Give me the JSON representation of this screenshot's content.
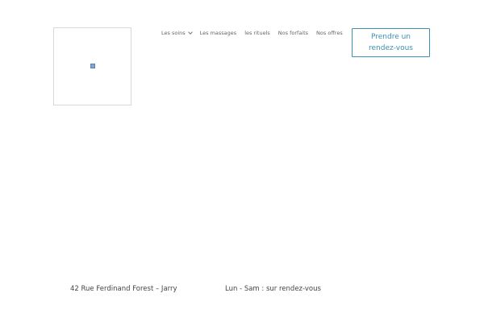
{
  "nav": {
    "items": [
      {
        "label": "Les soins",
        "has_dropdown": true
      },
      {
        "label": "Les massages",
        "has_dropdown": false
      },
      {
        "label": "les rituels",
        "has_dropdown": false
      },
      {
        "label": "Nos forfaits",
        "has_dropdown": false
      },
      {
        "label": "Nos offres",
        "has_dropdown": false
      }
    ]
  },
  "header": {
    "logo_icon": "broken-image-icon",
    "cta_label": "Prendre un rendez-vous"
  },
  "footer": {
    "address": "42 Rue Ferdinand Forest – Jarry",
    "hours": "Lun - Sam : sur rendez-vous"
  },
  "colors": {
    "accent": "#3e8fb5",
    "text": "#444444",
    "nav_text": "#666666",
    "border": "#d8d8d8"
  }
}
